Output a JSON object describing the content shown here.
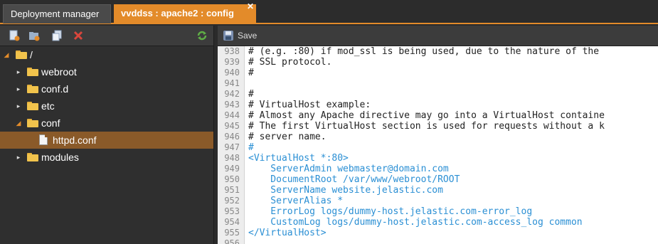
{
  "tabs": {
    "deployment_manager": "Deployment manager",
    "config": "vvddss : apache2 : config",
    "close_glyph": "✕"
  },
  "left_toolbar": {
    "icons": [
      "new-file-icon",
      "new-folder-icon",
      "copy-icon",
      "delete-icon",
      "refresh-icon"
    ]
  },
  "tree": {
    "root": "/",
    "items": [
      {
        "label": "webroot"
      },
      {
        "label": "conf.d"
      },
      {
        "label": "etc"
      },
      {
        "label": "conf"
      },
      {
        "label": "httpd.conf"
      },
      {
        "label": "modules"
      }
    ]
  },
  "editor": {
    "save_label": "Save",
    "lines": [
      {
        "n": "938",
        "text": "# (e.g. :80) if mod_ssl is being used, due to the nature of the",
        "kind": "comment"
      },
      {
        "n": "939",
        "text": "# SSL protocol.",
        "kind": "comment"
      },
      {
        "n": "940",
        "text": "#",
        "kind": "comment"
      },
      {
        "n": "941",
        "text": "",
        "kind": "comment"
      },
      {
        "n": "942",
        "text": "#",
        "kind": "comment"
      },
      {
        "n": "943",
        "text": "# VirtualHost example:",
        "kind": "comment"
      },
      {
        "n": "944",
        "text": "# Almost any Apache directive may go into a VirtualHost containe",
        "kind": "comment"
      },
      {
        "n": "945",
        "text": "# The first VirtualHost section is used for requests without a k",
        "kind": "comment"
      },
      {
        "n": "946",
        "text": "# server name.",
        "kind": "comment"
      },
      {
        "n": "947",
        "text": "#",
        "kind": "tag"
      },
      {
        "n": "948",
        "text": "<VirtualHost *:80>",
        "kind": "tag"
      },
      {
        "n": "949",
        "text": "    ServerAdmin webmaster@domain.com",
        "kind": "attr"
      },
      {
        "n": "950",
        "text": "    DocumentRoot /var/www/webroot/ROOT",
        "kind": "attr"
      },
      {
        "n": "951",
        "text": "    ServerName website.jelastic.com",
        "kind": "attr"
      },
      {
        "n": "952",
        "text": "    ServerAlias *",
        "kind": "attr"
      },
      {
        "n": "953",
        "text": "    ErrorLog logs/dummy-host.jelastic.com-error_log",
        "kind": "attr"
      },
      {
        "n": "954",
        "text": "    CustomLog logs/dummy-host.jelastic.com-access_log common",
        "kind": "attr"
      },
      {
        "n": "955",
        "text": "</VirtualHost>",
        "kind": "tag"
      },
      {
        "n": "956",
        "text": "",
        "kind": "comment"
      }
    ]
  },
  "colors": {
    "accent": "#e38b2a",
    "selection": "#8a5a29",
    "code_tag": "#2a8fd4"
  }
}
